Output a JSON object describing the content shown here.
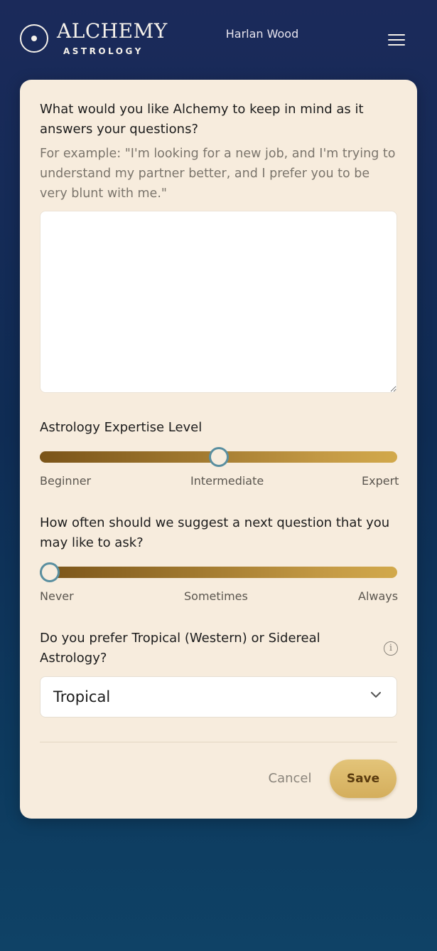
{
  "header": {
    "logo_word": "ALCHEMY",
    "logo_sub": "ASTROLOGY",
    "user_name": "Harlan Wood",
    "menu_icon": "hamburger-icon"
  },
  "form": {
    "context_question": "What would you like Alchemy to keep in mind as it answers your questions?",
    "context_hint": "For example: \"I'm looking for a new job, and I'm trying to understand my partner better, and I prefer you to be very blunt with me.\"",
    "context_value": "",
    "expertise": {
      "label": "Astrology Expertise Level",
      "ticks": [
        "Beginner",
        "Intermediate",
        "Expert"
      ],
      "value": 0.5
    },
    "suggest": {
      "label": "How often should we suggest a next question that you may like to ask?",
      "ticks": [
        "Never",
        "Sometimes",
        "Always"
      ],
      "value": 0
    },
    "zodiac": {
      "label": "Do you prefer Tropical (Western) or Sidereal Astrology?",
      "info_icon": "info-icon",
      "selected": "Tropical"
    },
    "cancel_label": "Cancel",
    "save_label": "Save"
  },
  "colors": {
    "card": "#f7ecdd",
    "slider_start": "#7a5419",
    "slider_end": "#d2a94b",
    "thumb_border": "#5a8fa0",
    "save_button": "#dcb868"
  }
}
